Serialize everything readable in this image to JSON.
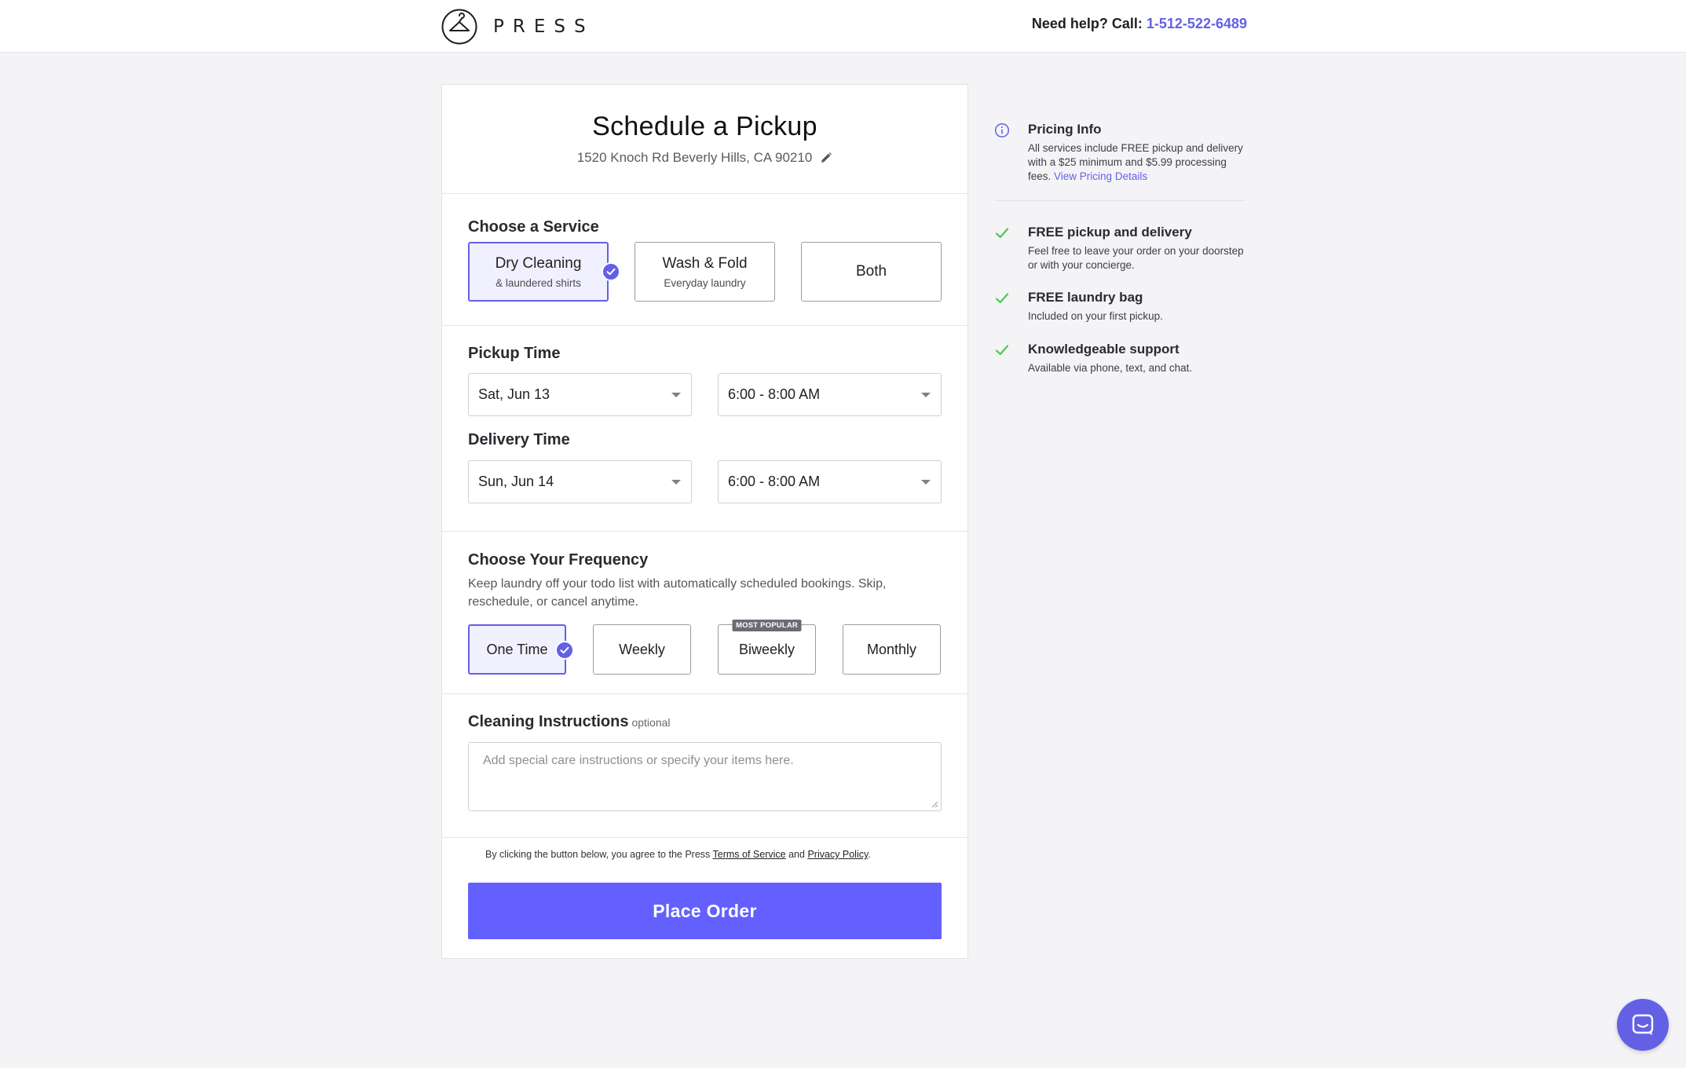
{
  "brand": {
    "name": "PRESS"
  },
  "help": {
    "prefix": "Need help? Call: ",
    "phone": "1-512-522-6489"
  },
  "schedule": {
    "title": "Schedule a Pickup",
    "address": "1520 Knoch Rd Beverly Hills, CA 90210"
  },
  "service": {
    "title": "Choose a Service",
    "options": [
      {
        "label": "Dry Cleaning",
        "sub": "& laundered shirts",
        "selected": true
      },
      {
        "label": "Wash & Fold",
        "sub": "Everyday laundry",
        "selected": false
      },
      {
        "label": "Both",
        "sub": "",
        "selected": false
      }
    ]
  },
  "pickup": {
    "title": "Pickup Time",
    "date": "Sat, Jun 13",
    "time": "6:00 - 8:00 AM"
  },
  "delivery": {
    "title": "Delivery Time",
    "date": "Sun, Jun 14",
    "time": "6:00 - 8:00 AM"
  },
  "frequency": {
    "title": "Choose Your Frequency",
    "description": "Keep laundry off your todo list with automatically scheduled bookings. Skip, reschedule, or cancel anytime.",
    "options": [
      {
        "label": "One Time",
        "selected": true
      },
      {
        "label": "Weekly",
        "selected": false
      },
      {
        "label": "Biweekly",
        "selected": false,
        "badge": "MOST POPULAR"
      },
      {
        "label": "Monthly",
        "selected": false
      }
    ]
  },
  "instructions": {
    "title": "Cleaning Instructions",
    "optional": "optional",
    "placeholder": "Add special care instructions or specify your items here."
  },
  "terms": {
    "prefix": "By clicking the button below, you agree to the Press ",
    "tos": "Terms of Service",
    "and": " and ",
    "privacy": "Privacy Policy",
    "suffix": "."
  },
  "place_order": "Place Order",
  "sidebar": {
    "pricing": {
      "title": "Pricing Info",
      "text": "All services include FREE pickup and delivery with a $25 minimum and $5.99 processing fees. ",
      "link": "View Pricing Details"
    },
    "features": [
      {
        "title": "FREE pickup and delivery",
        "text": "Feel free to leave your order on your doorstep or with your concierge."
      },
      {
        "title": "FREE laundry bag",
        "text": "Included on your first pickup."
      },
      {
        "title": "Knowledgeable support",
        "text": "Available via phone, text, and chat."
      }
    ]
  },
  "colors": {
    "accent": "#6360e6",
    "button": "#6360ff",
    "check": "#4cc94f",
    "page_bg": "#f4f4f6"
  },
  "icons": [
    "hanger-logo-icon",
    "pencil-icon",
    "check-circle-icon",
    "info-icon",
    "checkmark-icon",
    "chat-icon",
    "resize-grip-icon"
  ]
}
